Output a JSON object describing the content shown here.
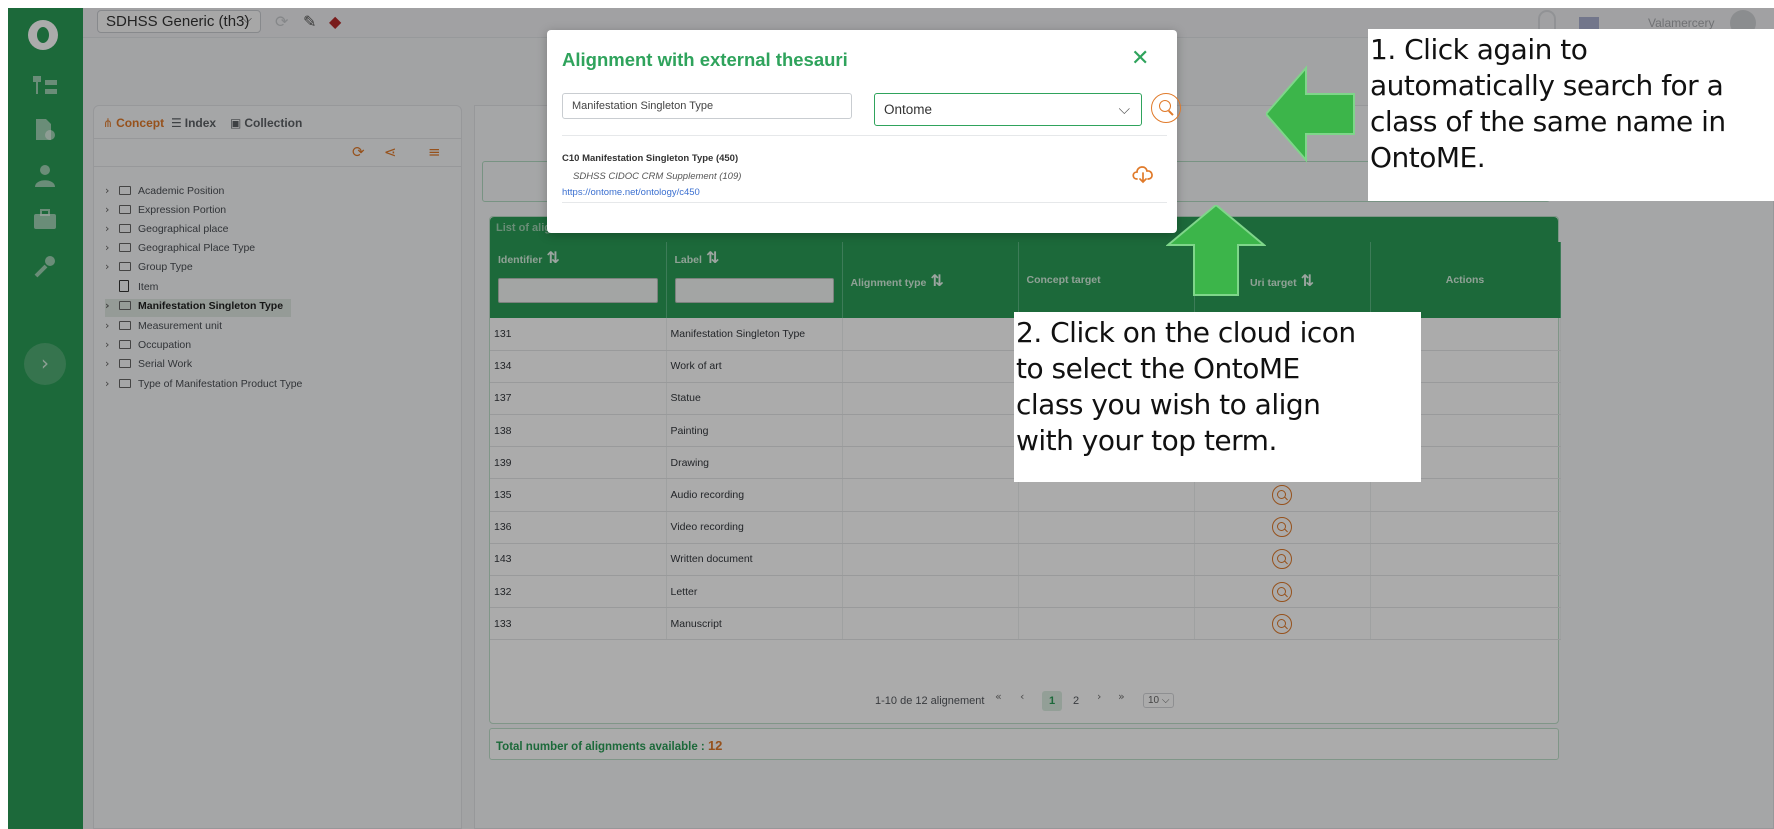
{
  "topbar": {
    "thesaurus": "SDHSS Generic (th3)",
    "user": "Valamercery"
  },
  "tree": {
    "tabs": [
      "Concept",
      "Index",
      "Collection"
    ],
    "items": [
      {
        "label": "Academic Position",
        "type": "folder"
      },
      {
        "label": "Expression Portion",
        "type": "folder"
      },
      {
        "label": "Geographical place",
        "type": "folder"
      },
      {
        "label": "Geographical Place Type",
        "type": "folder"
      },
      {
        "label": "Group Type",
        "type": "folder"
      },
      {
        "label": "Item",
        "type": "file"
      },
      {
        "label": "Manifestation Singleton Type",
        "type": "folder",
        "selected": true
      },
      {
        "label": "Measurement unit",
        "type": "folder"
      },
      {
        "label": "Occupation",
        "type": "folder"
      },
      {
        "label": "Serial Work",
        "type": "folder"
      },
      {
        "label": "Type of Manifestation Product Type",
        "type": "folder"
      }
    ]
  },
  "alignments": {
    "title": "List of alignments",
    "columns": [
      "Identifier",
      "Label",
      "Alignment type",
      "Concept target",
      "Uri target",
      "Actions"
    ],
    "rows": [
      {
        "id": "131",
        "label": "Manifestation Singleton Type"
      },
      {
        "id": "134",
        "label": "Work of art"
      },
      {
        "id": "137",
        "label": "Statue"
      },
      {
        "id": "138",
        "label": "Painting"
      },
      {
        "id": "139",
        "label": "Drawing"
      },
      {
        "id": "135",
        "label": "Audio recording"
      },
      {
        "id": "136",
        "label": "Video recording"
      },
      {
        "id": "143",
        "label": "Written document"
      },
      {
        "id": "132",
        "label": "Letter"
      },
      {
        "id": "133",
        "label": "Manuscript"
      }
    ],
    "pagination": {
      "summary": "1-10 de 12 alignement",
      "current_page": "1",
      "next_page": "2",
      "page_size": "10"
    },
    "total_label": "Total number of alignments available :",
    "total": "12"
  },
  "modal": {
    "title": "Alignment with external thesauri",
    "search_value": "Manifestation Singleton Type",
    "source": "Ontome",
    "result": {
      "title": "C10 Manifestation Singleton Type (450)",
      "ontology": "SDHSS CIDOC CRM Supplement (109)",
      "url": "https://ontome.net/ontology/c450"
    }
  },
  "annotations": {
    "note1": [
      "1. Click again to",
      "automatically search for a",
      "class of the same name in",
      "OntoME."
    ],
    "note2": [
      "2. Click on the cloud icon",
      "to select the OntoME",
      "class you wish to align",
      "with your top term."
    ]
  },
  "colors": {
    "brand_green": "#2b9d57",
    "accent_orange": "#e07a2a",
    "arrow_green": "#3cb54a"
  }
}
